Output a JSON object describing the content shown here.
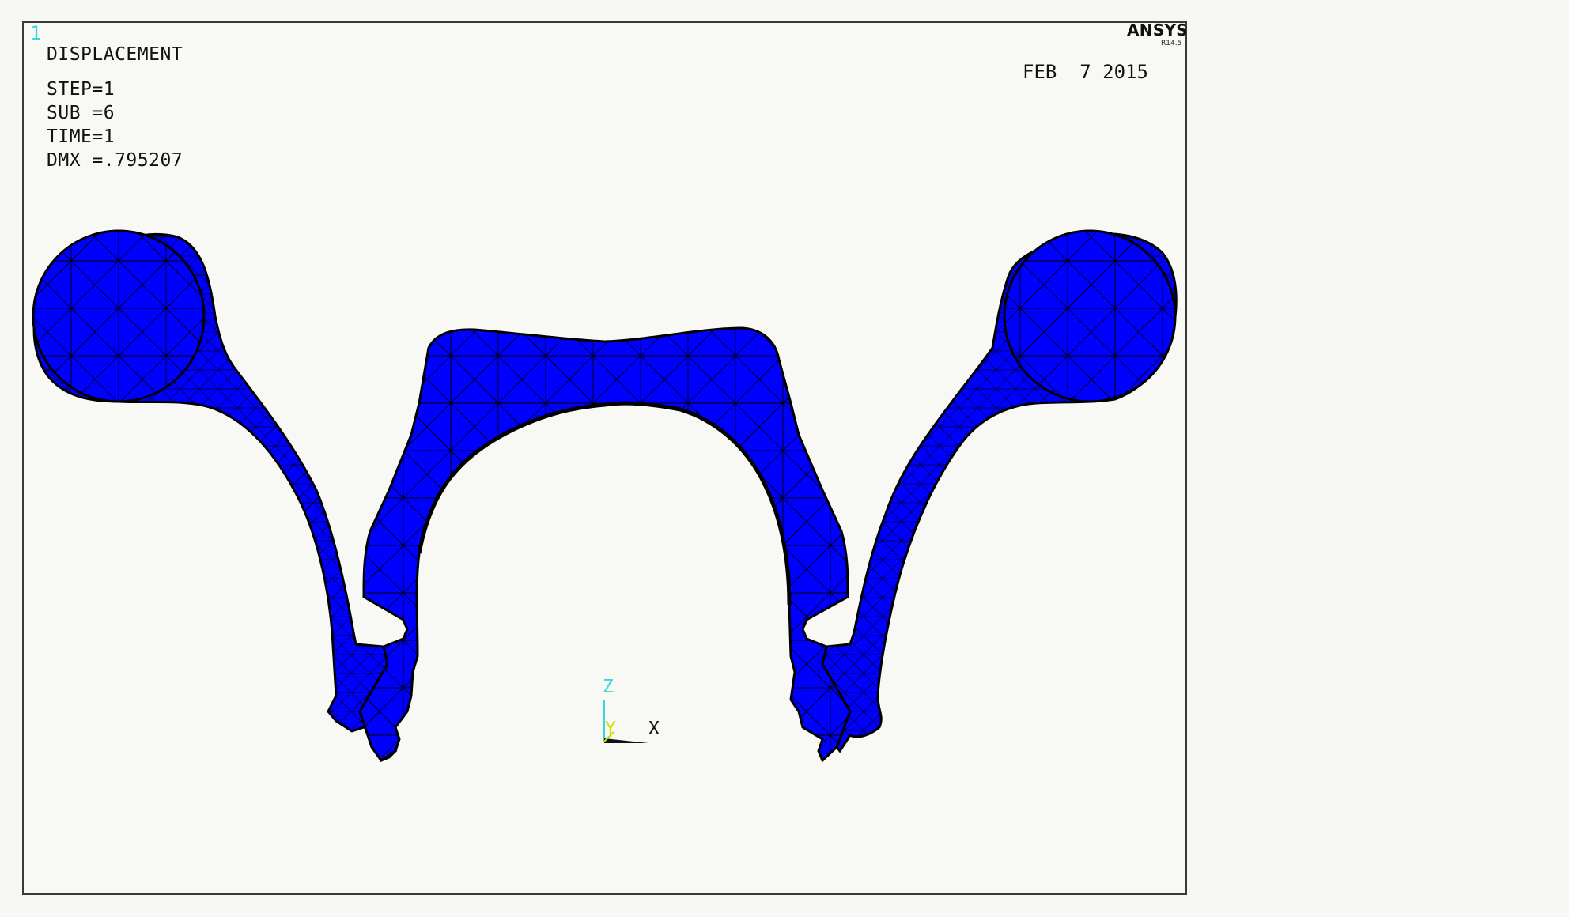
{
  "viewport": {
    "window_number": "1"
  },
  "result_info": {
    "title": "DISPLACEMENT",
    "step": "STEP=1",
    "sub": "SUB =6",
    "time": "TIME=1",
    "dmx": "DMX =.795207"
  },
  "branding": {
    "name": "ANSYS",
    "version": "R14.5"
  },
  "date": "FEB  7 2015",
  "triad": {
    "z_label": "Z",
    "y_label": "Y",
    "x_label": "X",
    "colors": {
      "z": "#3fd5dd",
      "y": "#c9e000",
      "x": "#111111"
    }
  },
  "model": {
    "fill_color": "#0000ff",
    "edge_color": "#000000",
    "mesh": "tetrahedral"
  }
}
